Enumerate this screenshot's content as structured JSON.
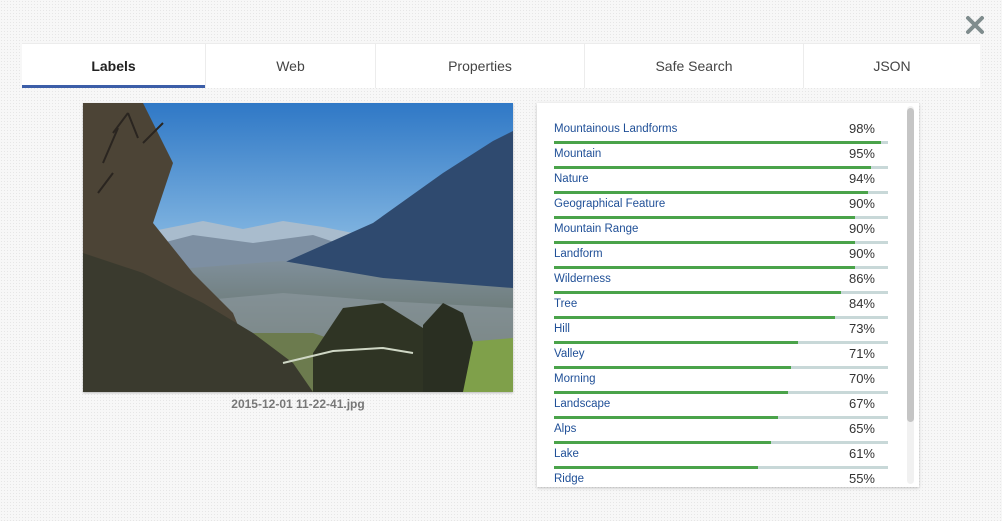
{
  "tabs": [
    {
      "label": "Labels",
      "active": true
    },
    {
      "label": "Web",
      "active": false
    },
    {
      "label": "Properties",
      "active": false
    },
    {
      "label": "Safe Search",
      "active": false
    },
    {
      "label": "JSON",
      "active": false
    }
  ],
  "close_icon": "close-x-icon",
  "image": {
    "filename": "2015-12-01 11-22-41.jpg"
  },
  "labels": [
    {
      "name": "Mountainous Landforms",
      "score": "98%",
      "value": 0.98
    },
    {
      "name": "Mountain",
      "score": "95%",
      "value": 0.95
    },
    {
      "name": "Nature",
      "score": "94%",
      "value": 0.94
    },
    {
      "name": "Geographical Feature",
      "score": "90%",
      "value": 0.9
    },
    {
      "name": "Mountain Range",
      "score": "90%",
      "value": 0.9
    },
    {
      "name": "Landform",
      "score": "90%",
      "value": 0.9
    },
    {
      "name": "Wilderness",
      "score": "86%",
      "value": 0.86
    },
    {
      "name": "Tree",
      "score": "84%",
      "value": 0.84
    },
    {
      "name": "Hill",
      "score": "73%",
      "value": 0.73
    },
    {
      "name": "Valley",
      "score": "71%",
      "value": 0.71
    },
    {
      "name": "Morning",
      "score": "70%",
      "value": 0.7
    },
    {
      "name": "Landscape",
      "score": "67%",
      "value": 0.67
    },
    {
      "name": "Alps",
      "score": "65%",
      "value": 0.65
    },
    {
      "name": "Lake",
      "score": "61%",
      "value": 0.61
    },
    {
      "name": "Ridge",
      "score": "55%",
      "value": 0.55
    }
  ],
  "colors": {
    "active_tab_underline": "#3c5ea8",
    "label_text": "#1f4f97",
    "bar_fill": "#4aa34a",
    "bar_track": "#c8d8d8"
  }
}
